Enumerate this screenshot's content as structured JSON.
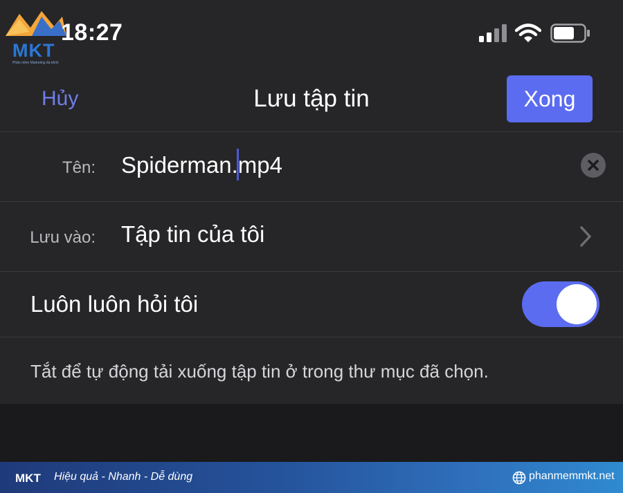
{
  "status_bar": {
    "time": "18:27",
    "logo": {
      "text": "MKT",
      "subtitle": "Phần mềm Marketing đa kênh"
    },
    "icons": [
      "cellular-signal-icon",
      "wifi-icon",
      "battery-icon"
    ]
  },
  "nav": {
    "cancel_label": "Hủy",
    "title": "Lưu tập tin",
    "done_label": "Xong"
  },
  "form": {
    "name_label": "Tên:",
    "name_value": "Spiderman.mp4",
    "save_label": "Lưu vào:",
    "save_value": "Tập tin của tôi",
    "ask_label": "Luôn luôn hỏi tôi",
    "ask_enabled": true,
    "note": "Tắt để tự động tải xuống tập tin ở trong thư mục đã chọn."
  },
  "footer": {
    "logo_text": "MKT",
    "slogan": "Hiệu quả - Nhanh  - Dễ dùng",
    "url": "phanmemmkt.net"
  },
  "colors": {
    "accent": "#5b6cf0",
    "cancel": "#6f7ee8",
    "background": "#1c1c1e",
    "row": "#262628"
  }
}
